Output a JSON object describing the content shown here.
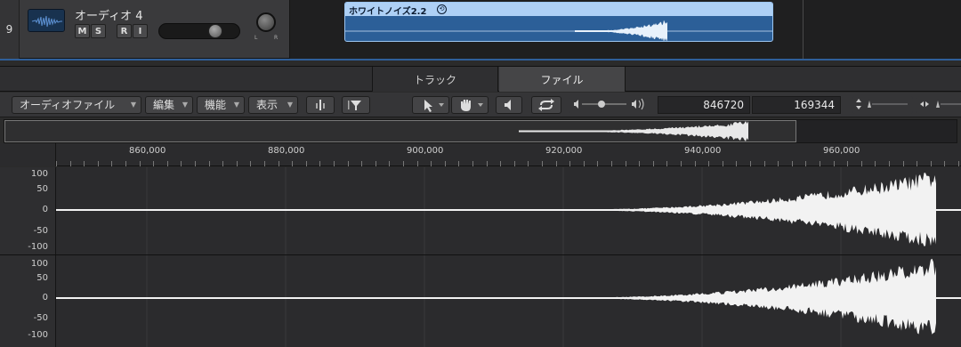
{
  "track": {
    "number": "9",
    "name": "オーディオ 4",
    "buttons": [
      "M",
      "S",
      "R",
      "I"
    ],
    "pan_labels": [
      "L",
      "R"
    ],
    "icon": "waveform-icon"
  },
  "region": {
    "title": "ホワイトノイズ2.2",
    "loop_icon": "loop-icon",
    "color": "#2c5f98"
  },
  "editor": {
    "tabs": [
      "トラック",
      "ファイル"
    ],
    "active_tab": "ファイル",
    "menus": [
      "オーディオファイル",
      "編集",
      "機能",
      "表示"
    ],
    "fields": {
      "start": "846720",
      "length": "169344"
    },
    "ruler": [
      "860,000",
      "880,000",
      "900,000",
      "920,000",
      "940,000",
      "960,000"
    ],
    "channel_scale": [
      "100",
      "50",
      "0",
      "-50",
      "-100"
    ]
  }
}
